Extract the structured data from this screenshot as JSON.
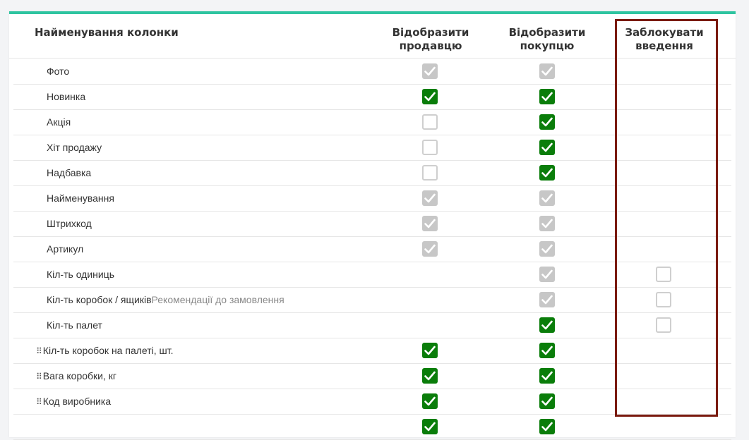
{
  "header": {
    "name": "Найменування колонки",
    "seller": "Відобразити продавцю",
    "buyer": "Відобразити покупцю",
    "block": "Заблокувати введення"
  },
  "colors": {
    "accent_top": "#2ec4a0",
    "checked": "#0a7d0a",
    "disabled": "#c7c7c7",
    "highlight_frame": "#7a1a0f"
  },
  "rows": [
    {
      "label": "Фото",
      "hint": "",
      "drag": false,
      "seller": "disabled",
      "buyer": "disabled",
      "block": "none"
    },
    {
      "label": "Новинка",
      "hint": "",
      "drag": false,
      "seller": "checked",
      "buyer": "checked",
      "block": "none"
    },
    {
      "label": "Акція",
      "hint": "",
      "drag": false,
      "seller": "unchecked",
      "buyer": "checked",
      "block": "none"
    },
    {
      "label": "Хіт продажу",
      "hint": "",
      "drag": false,
      "seller": "unchecked",
      "buyer": "checked",
      "block": "none"
    },
    {
      "label": "Надбавка",
      "hint": "",
      "drag": false,
      "seller": "unchecked",
      "buyer": "checked",
      "block": "none"
    },
    {
      "label": "Найменування",
      "hint": "",
      "drag": false,
      "seller": "disabled",
      "buyer": "disabled",
      "block": "none"
    },
    {
      "label": "Штрихкод",
      "hint": "",
      "drag": false,
      "seller": "disabled",
      "buyer": "disabled",
      "block": "none"
    },
    {
      "label": "Артикул",
      "hint": "",
      "drag": false,
      "seller": "disabled",
      "buyer": "disabled",
      "block": "none"
    },
    {
      "label": "Кіл-ть одиниць",
      "hint": "",
      "drag": false,
      "seller": "none",
      "buyer": "disabled",
      "block": "unchecked"
    },
    {
      "label": "Кіл-ть коробок / ящиків",
      "hint": "Рекомендації до замовлення",
      "drag": false,
      "seller": "none",
      "buyer": "disabled",
      "block": "unchecked"
    },
    {
      "label": "Кіл-ть палет",
      "hint": "",
      "drag": false,
      "seller": "none",
      "buyer": "checked",
      "block": "unchecked"
    },
    {
      "label": "Кіл-ть коробок на палеті, шт.",
      "hint": "",
      "drag": true,
      "seller": "checked",
      "buyer": "checked",
      "block": "none"
    },
    {
      "label": "Вага коробки, кг",
      "hint": "",
      "drag": true,
      "seller": "checked",
      "buyer": "checked",
      "block": "none"
    },
    {
      "label": "Код виробника",
      "hint": "",
      "drag": true,
      "seller": "checked",
      "buyer": "checked",
      "block": "none"
    },
    {
      "label": "",
      "hint": "",
      "drag": false,
      "seller": "checked",
      "buyer": "checked",
      "block": "none"
    }
  ]
}
